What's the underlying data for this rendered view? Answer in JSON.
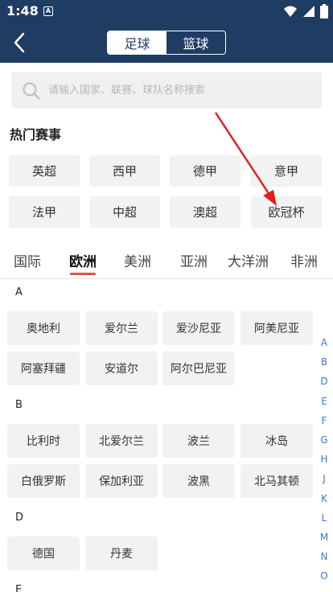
{
  "status": {
    "time": "1:48",
    "notif_glyph": "A"
  },
  "header": {
    "tab_football": "足球",
    "tab_basketball": "篮球"
  },
  "search": {
    "placeholder": "请输入国家、联赛、球队名称搜索"
  },
  "hot": {
    "title": "热门赛事",
    "items": [
      "英超",
      "西甲",
      "德甲",
      "意甲",
      "法甲",
      "中超",
      "澳超",
      "欧冠杯"
    ]
  },
  "regions": [
    "国际",
    "欧洲",
    "美洲",
    "亚洲",
    "大洋洲",
    "非洲"
  ],
  "groups": [
    {
      "letter": "A",
      "countries": [
        "奥地利",
        "爱尔兰",
        "爱沙尼亚",
        "阿美尼亚",
        "阿塞拜疆",
        "安道尔",
        "阿尔巴尼亚"
      ]
    },
    {
      "letter": "B",
      "countries": [
        "比利时",
        "北爱尔兰",
        "波兰",
        "冰岛",
        "白俄罗斯",
        "保加利亚",
        "波黑",
        "北马其顿"
      ]
    },
    {
      "letter": "D",
      "countries": [
        "德国",
        "丹麦"
      ]
    },
    {
      "letter": "E",
      "countries": []
    }
  ],
  "index_letters": [
    "A",
    "B",
    "D",
    "E",
    "F",
    "G",
    "H",
    "J",
    "K",
    "L",
    "M",
    "N",
    "O"
  ],
  "colors": {
    "header": "#1f3c63",
    "accent": "#e0534a",
    "index": "#3a7bd5",
    "arrow": "#e02020"
  }
}
